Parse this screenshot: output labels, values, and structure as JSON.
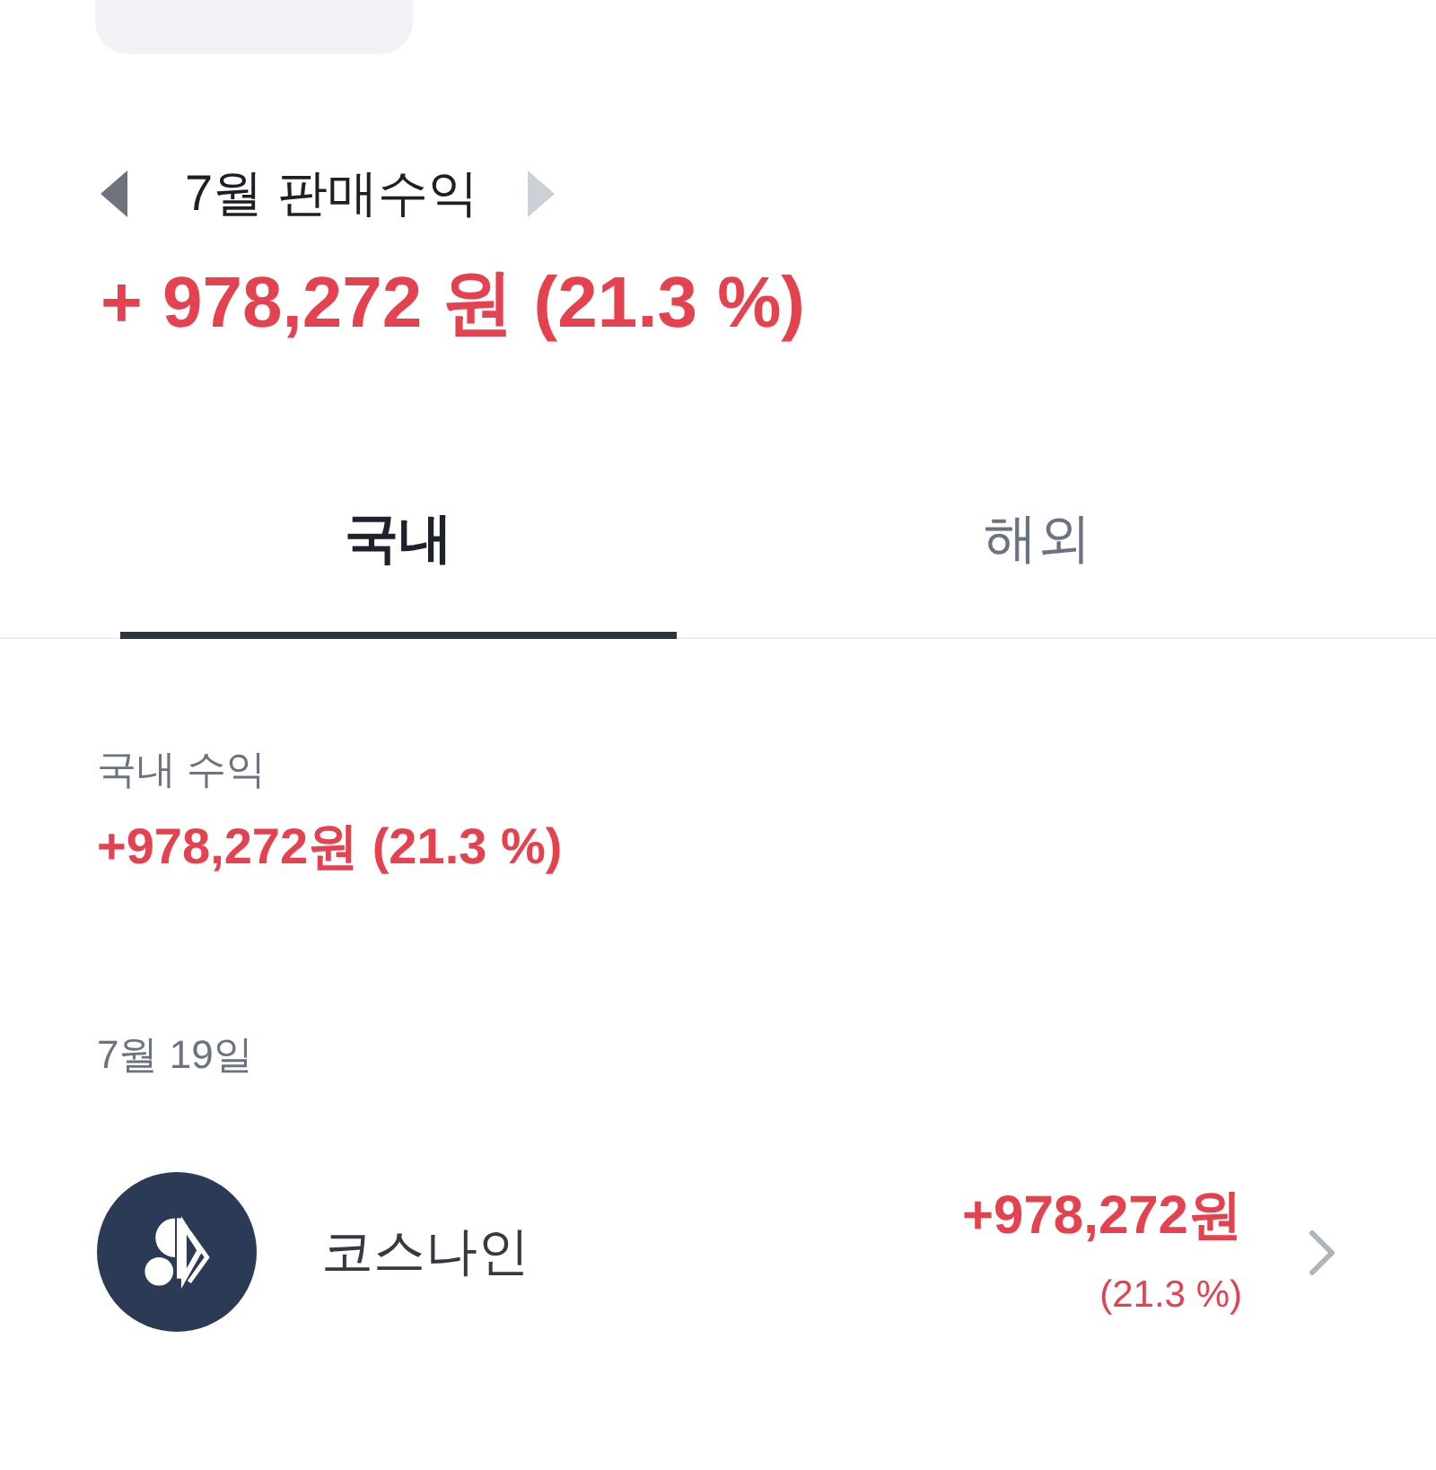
{
  "header": {
    "prev_month": {
      "disabled": false
    },
    "title": "7월 판매수익",
    "next_month": {
      "disabled": true
    },
    "total": "+ 978,272 원 (21.3 %)"
  },
  "tabs": [
    {
      "label": "국내",
      "selected": true
    },
    {
      "label": "해외",
      "selected": false
    }
  ],
  "summary": {
    "label": "국내 수익",
    "amount": "+978,272원 (21.3 %)"
  },
  "groups": [
    {
      "date": "7월 19일",
      "items": [
        {
          "name": "코스나인",
          "amount": "+978,272원",
          "rate": "(21.3 %)"
        }
      ]
    }
  ]
}
